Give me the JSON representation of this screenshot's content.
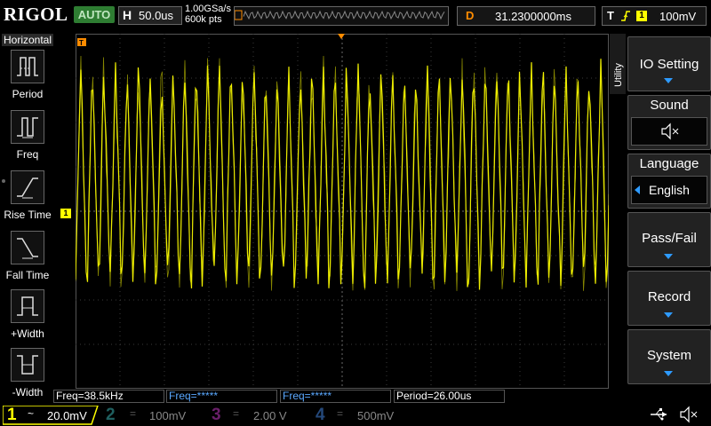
{
  "header": {
    "logo": "RIGOL",
    "run_status": "AUTO",
    "timebase_label": "H",
    "timebase_value": "50.0us",
    "sample_rate": "1.00GSa/s",
    "memory_depth": "600k pts",
    "trigger_pos_label": "D",
    "trigger_pos_value": "31.2300000ms",
    "trigger_label": "T",
    "trigger_source": "1",
    "trigger_level": "100mV"
  },
  "left_menu": {
    "title": "Horizontal",
    "items": [
      {
        "label": "Period",
        "icon": "period-icon"
      },
      {
        "label": "Freq",
        "icon": "freq-icon"
      },
      {
        "label": "Rise Time",
        "icon": "rise-time-icon"
      },
      {
        "label": "Fall Time",
        "icon": "fall-time-icon"
      },
      {
        "label": "+Width",
        "icon": "positive-width-icon"
      },
      {
        "label": "-Width",
        "icon": "negative-width-icon"
      }
    ]
  },
  "right_menu": {
    "tab_label": "Utility",
    "items": [
      {
        "label": "IO Setting"
      },
      {
        "label": "Sound",
        "value_icon": "speaker-muted-icon"
      },
      {
        "label": "Language",
        "value": "English"
      },
      {
        "label": "Pass/Fail"
      },
      {
        "label": "Record"
      },
      {
        "label": "System"
      }
    ]
  },
  "measurements": [
    {
      "text": "Freq=38.5kHz",
      "color": "#ffffff"
    },
    {
      "text": "Freq=*****",
      "color": "#5aa8ff"
    },
    {
      "text": "Freq=*****",
      "color": "#5aa8ff"
    },
    {
      "text": "Period=26.00us",
      "color": "#ffffff"
    }
  ],
  "channels": [
    {
      "num": "1",
      "coupling": "~",
      "scale": "20.0mV",
      "color": "#ffff00",
      "active": true
    },
    {
      "num": "2",
      "coupling": "=",
      "scale": "100mV",
      "color": "#00e5e5",
      "active": false
    },
    {
      "num": "3",
      "coupling": "=",
      "scale": "2.00 V",
      "color": "#ff3cff",
      "active": false
    },
    {
      "num": "4",
      "coupling": "=",
      "scale": "500mV",
      "color": "#3c8cff",
      "active": false
    }
  ],
  "ch1_marker": "1",
  "trigger_marker": "T",
  "colors": {
    "ch1": "#ffff00",
    "accent": "#ff8c00",
    "menu_arrow": "#2e9bff"
  }
}
